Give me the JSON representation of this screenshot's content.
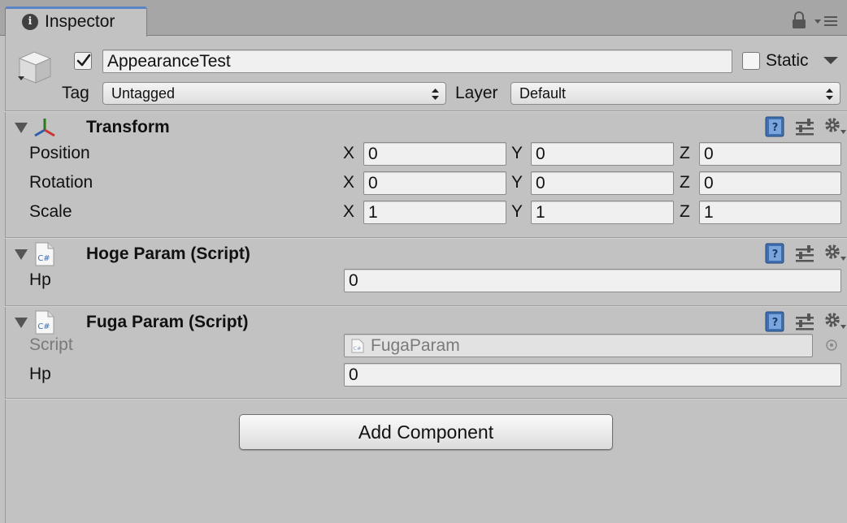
{
  "tab": {
    "title": "Inspector",
    "info_icon": "info-circle-icon"
  },
  "toolbar": {
    "lock_icon": "lock-icon",
    "menu_icon": "context-menu-icon"
  },
  "gameobject": {
    "active": true,
    "name": "AppearanceTest",
    "static_label": "Static",
    "static_checked": false,
    "tag_label": "Tag",
    "tag_value": "Untagged",
    "layer_label": "Layer",
    "layer_value": "Default"
  },
  "components": {
    "transform": {
      "title": "Transform",
      "position": {
        "label": "Position",
        "x": "0",
        "y": "0",
        "z": "0"
      },
      "rotation": {
        "label": "Rotation",
        "x": "0",
        "y": "0",
        "z": "0"
      },
      "scale": {
        "label": "Scale",
        "x": "1",
        "y": "1",
        "z": "1"
      },
      "axis": {
        "x": "X",
        "y": "Y",
        "z": "Z"
      }
    },
    "hoge": {
      "title": "Hoge Param (Script)",
      "icon_text": "C#",
      "hp_label": "Hp",
      "hp_value": "0"
    },
    "fuga": {
      "title": "Fuga Param (Script)",
      "icon_text": "C#",
      "script_label": "Script",
      "script_value": "FugaParam",
      "hp_label": "Hp",
      "hp_value": "0"
    }
  },
  "add_component_label": "Add Component",
  "colors": {
    "accent": "#5a84c6",
    "panel": "#c2c2c2",
    "field": "#f0f0f0"
  }
}
